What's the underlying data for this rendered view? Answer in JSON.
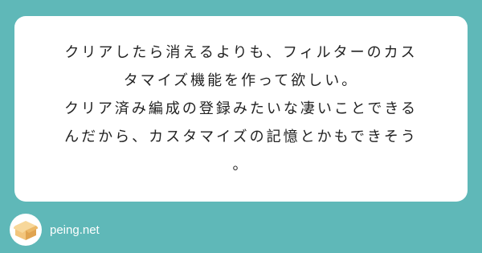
{
  "question": {
    "lines": [
      "クリアしたら消えるよりも、フィルターのカス",
      "タマイズ機能を作って欲しい。",
      "クリア済み編成の登録みたいな凄いことできる",
      "んだから、カスタマイズの記憶とかもできそう",
      "。"
    ]
  },
  "footer": {
    "logo_icon": "cardboard-box-icon",
    "site": "peing.net"
  },
  "colors": {
    "background": "#5fb8b8",
    "card": "#ffffff",
    "text": "#222222",
    "box_light": "#f2c57c",
    "box_dark": "#e0a450"
  }
}
